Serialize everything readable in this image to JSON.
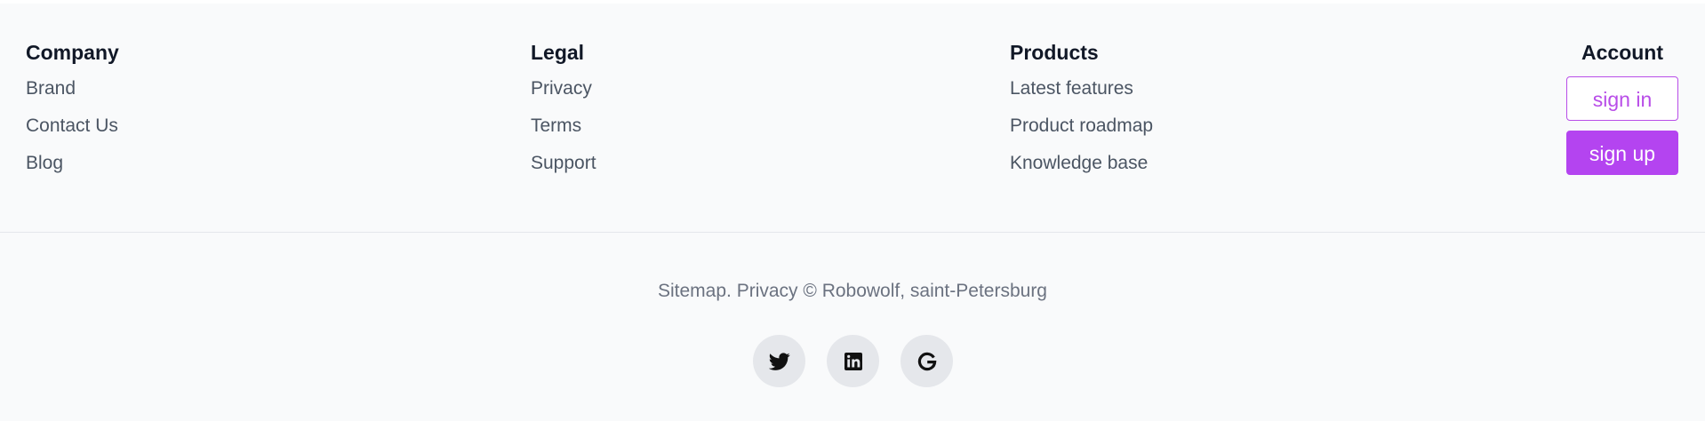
{
  "footer": {
    "columns": [
      {
        "title": "Company",
        "links": [
          "Brand",
          "Contact Us",
          "Blog"
        ]
      },
      {
        "title": "Legal",
        "links": [
          "Privacy",
          "Terms",
          "Support"
        ]
      },
      {
        "title": "Products",
        "links": [
          "Latest features",
          "Product roadmap",
          "Knowledge base"
        ]
      }
    ],
    "account": {
      "title": "Account",
      "sign_in_label": "sign in",
      "sign_up_label": "sign up"
    },
    "copyright": "Sitemap. Privacy © Robowolf, saint-Petersburg",
    "socials": [
      {
        "icon": "twitter-icon"
      },
      {
        "icon": "linkedin-icon"
      },
      {
        "icon": "google-icon"
      }
    ]
  },
  "colors": {
    "accent": "#b444f0",
    "background": "#f9fafb",
    "text_muted": "#4b5563"
  }
}
